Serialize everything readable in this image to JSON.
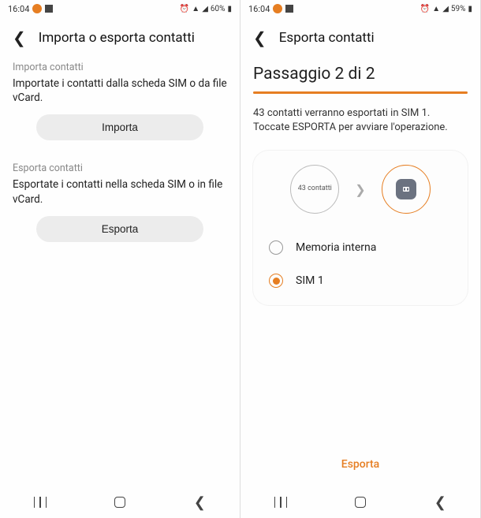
{
  "left": {
    "status": {
      "time": "16:04",
      "battery": "60%"
    },
    "header": {
      "title": "Importa o esporta contatti"
    },
    "import": {
      "label": "Importa contatti",
      "desc": "Importate i contatti dalla scheda SIM o da file vCard.",
      "button": "Importa"
    },
    "export": {
      "label": "Esporta contatti",
      "desc": "Esportate i contatti nella scheda SIM o in file vCard.",
      "button": "Esporta"
    }
  },
  "right": {
    "status": {
      "time": "16:04",
      "battery": "59%"
    },
    "header": {
      "title": "Esporta contatti"
    },
    "step_title": "Passaggio 2 di 2",
    "info": "43 contatti verranno esportati in SIM 1. Toccate ESPORTA per avviare l'operazione.",
    "source_label": "43 contatti",
    "options": {
      "internal": "Memoria interna",
      "sim": "SIM 1"
    },
    "action": "Esporta"
  }
}
